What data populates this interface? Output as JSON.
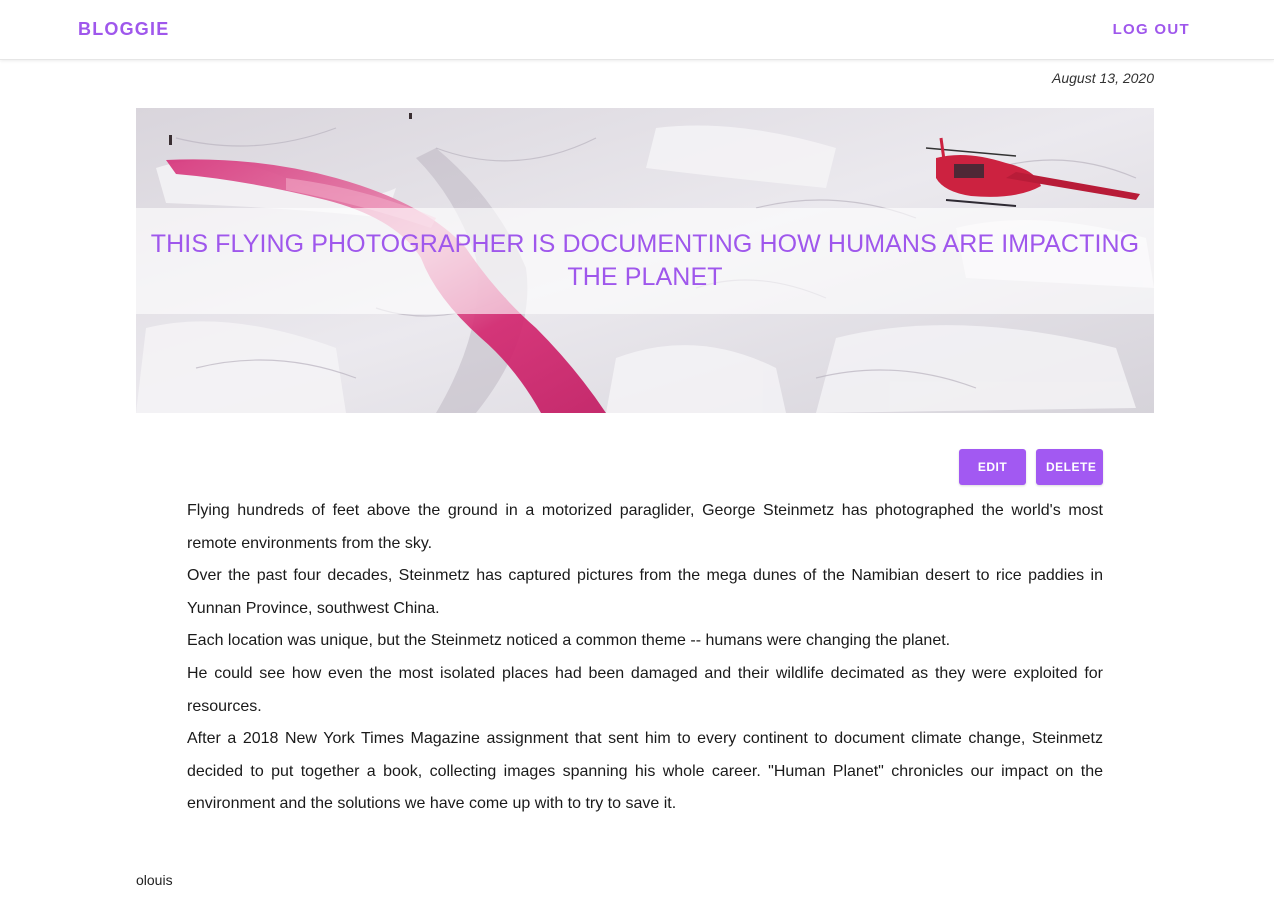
{
  "navbar": {
    "brand": "BLOGGIE",
    "logout_label": "LOG OUT"
  },
  "post": {
    "date": "August 13, 2020",
    "title": "THIS FLYING PHOTOGRAPHER IS DOCUMENTING HOW HUMANS ARE IMPACTING THE PLANET",
    "paragraphs": [
      "Flying hundreds of feet above the ground in a motorized paraglider, George Steinmetz has photographed the world's most remote environments from the sky.",
      "Over the past four decades, Steinmetz has captured pictures from the mega dunes of the Namibian desert to rice paddies in Yunnan Province, southwest China.",
      "Each location was unique, but the Steinmetz noticed a common theme -- humans were changing the planet.",
      "He could see how even the most isolated places had been damaged and their wildlife decimated as they were exploited for resources.",
      "After a 2018 New York Times Magazine assignment that sent him to every continent to document climate change, Steinmetz decided to put together a book, collecting images spanning his whole career. \"Human Planet\" chronicles our impact on the environment and the solutions we have come up with to try to save it."
    ],
    "author": "olouis"
  },
  "actions": {
    "edit_label": "EDIT",
    "delete_label": "DELETE"
  },
  "colors": {
    "accent": "#9f57ec",
    "button": "#a259f2",
    "ice": "#e4e1e6",
    "meltwater": "#d2246e"
  }
}
